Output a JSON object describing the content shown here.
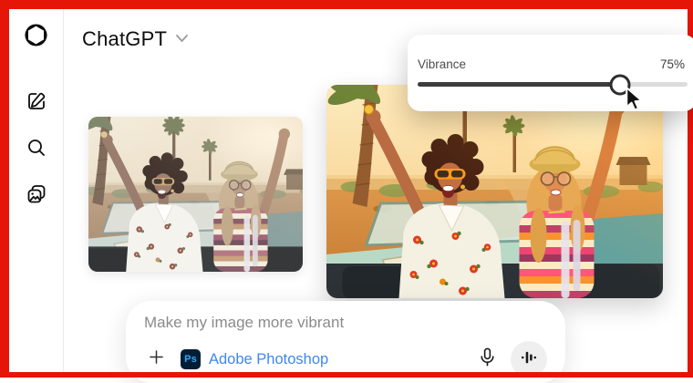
{
  "header": {
    "title": "ChatGPT"
  },
  "sidebar": {
    "items": [
      {
        "name": "openai-logo"
      },
      {
        "name": "new-chat"
      },
      {
        "name": "search"
      },
      {
        "name": "library"
      }
    ]
  },
  "vibrance_panel": {
    "label": "Vibrance",
    "value_label": "75%",
    "percent": 75
  },
  "composer": {
    "message": "Make my image more vibrant",
    "tool_badge": "Ps",
    "tool_label": "Adobe Photoshop"
  },
  "colors": {
    "frame_red": "#e51508",
    "photoshop_blue": "#3e87f0",
    "ps_badge_bg": "#001e36",
    "ps_badge_text": "#31a8ff",
    "slider_fill": "#3d3d3d",
    "slider_track": "#dcdcdc"
  }
}
